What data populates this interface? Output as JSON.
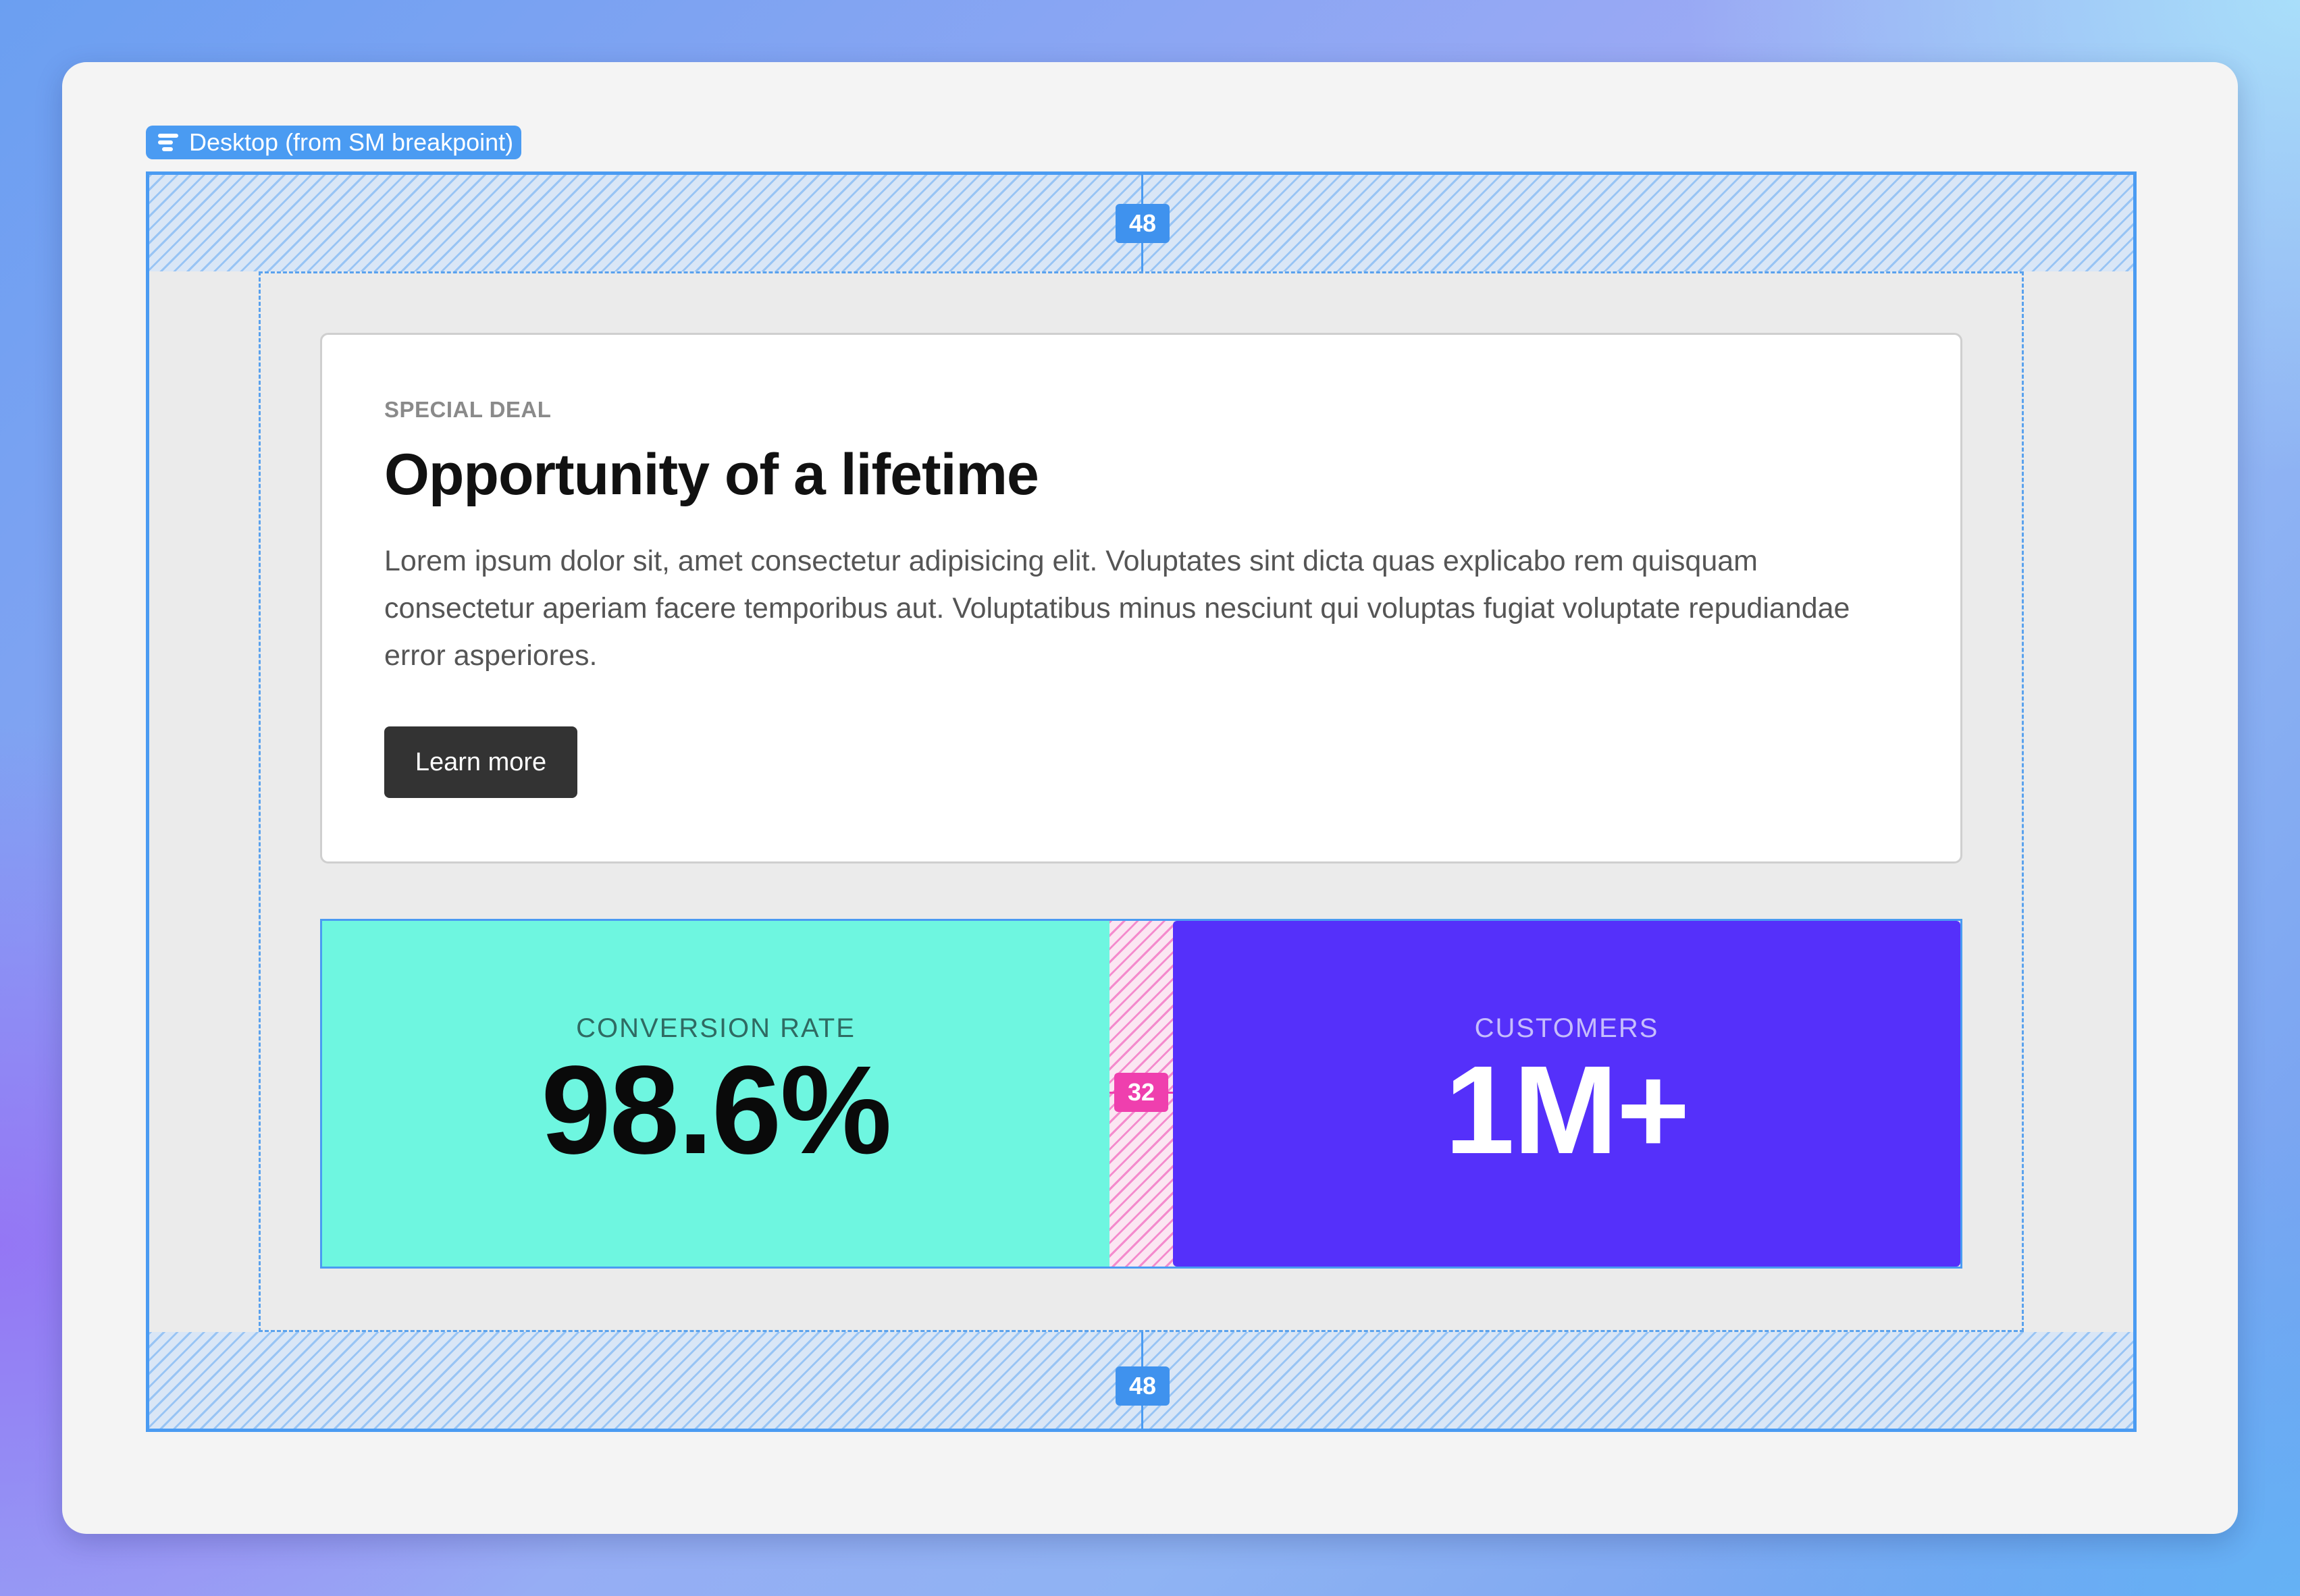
{
  "frame": {
    "label": "Desktop (from SM breakpoint)",
    "padding_top_badge": "48",
    "padding_bottom_badge": "48",
    "gap_badge": "32"
  },
  "card": {
    "eyebrow": "SPECIAL DEAL",
    "title": "Opportunity of a lifetime",
    "body": "Lorem ipsum dolor sit, amet consectetur adipisicing elit. Voluptates sint dicta quas explicabo rem quisquam consectetur aperiam facere temporibus aut. Voluptatibus minus nesciunt qui voluptas fugiat voluptate repudiandae error asperiores.",
    "button_label": "Learn more"
  },
  "stats": [
    {
      "label": "CONVERSION RATE",
      "value": "98.6%",
      "background": "#6ef6e0"
    },
    {
      "label": "CUSTOMERS",
      "value": "1M+",
      "background": "#5530fa"
    }
  ],
  "colors": {
    "guide_blue": "#4a9bf2",
    "gap_pink": "#ef3fae",
    "button_dark": "#333333"
  }
}
